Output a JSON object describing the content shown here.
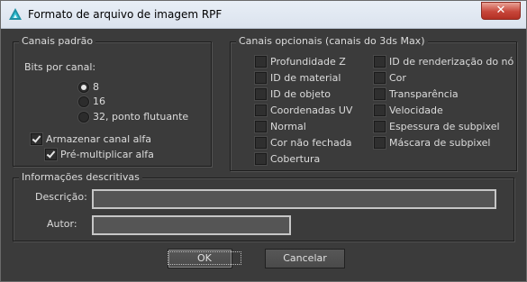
{
  "window": {
    "title": "Formato de arquivo de imagem RPF"
  },
  "standard_channels": {
    "legend": "Canais padrão",
    "bits_label": "Bits por canal:",
    "bits_options": [
      {
        "label": "8",
        "selected": true
      },
      {
        "label": "16",
        "selected": false
      },
      {
        "label": "32, ponto flutuante",
        "selected": false
      }
    ],
    "store_alpha": {
      "label": "Armazenar canal alfa",
      "checked": true
    },
    "premultiply_alpha": {
      "label": "Pré-multiplicar alfa",
      "checked": true
    }
  },
  "optional_channels": {
    "legend": "Canais opcionais (canais do 3ds Max)",
    "left": [
      {
        "label": "Profundidade Z",
        "checked": false
      },
      {
        "label": "ID de material",
        "checked": false
      },
      {
        "label": "ID de objeto",
        "checked": false
      },
      {
        "label": "Coordenadas UV",
        "checked": false
      },
      {
        "label": "Normal",
        "checked": false
      },
      {
        "label": "Cor não fechada",
        "checked": false
      },
      {
        "label": "Cobertura",
        "checked": false
      }
    ],
    "right": [
      {
        "label": "ID de renderização do nó",
        "checked": false
      },
      {
        "label": "Cor",
        "checked": false
      },
      {
        "label": "Transparência",
        "checked": false
      },
      {
        "label": "Velocidade",
        "checked": false
      },
      {
        "label": "Espessura de subpixel",
        "checked": false
      },
      {
        "label": "Máscara de subpixel",
        "checked": false
      }
    ]
  },
  "description": {
    "legend": "Informações descritivas",
    "description_label": "Descrição:",
    "description_value": "",
    "author_label": "Autor:",
    "author_value": ""
  },
  "buttons": {
    "ok": "OK",
    "cancel": "Cancelar"
  }
}
